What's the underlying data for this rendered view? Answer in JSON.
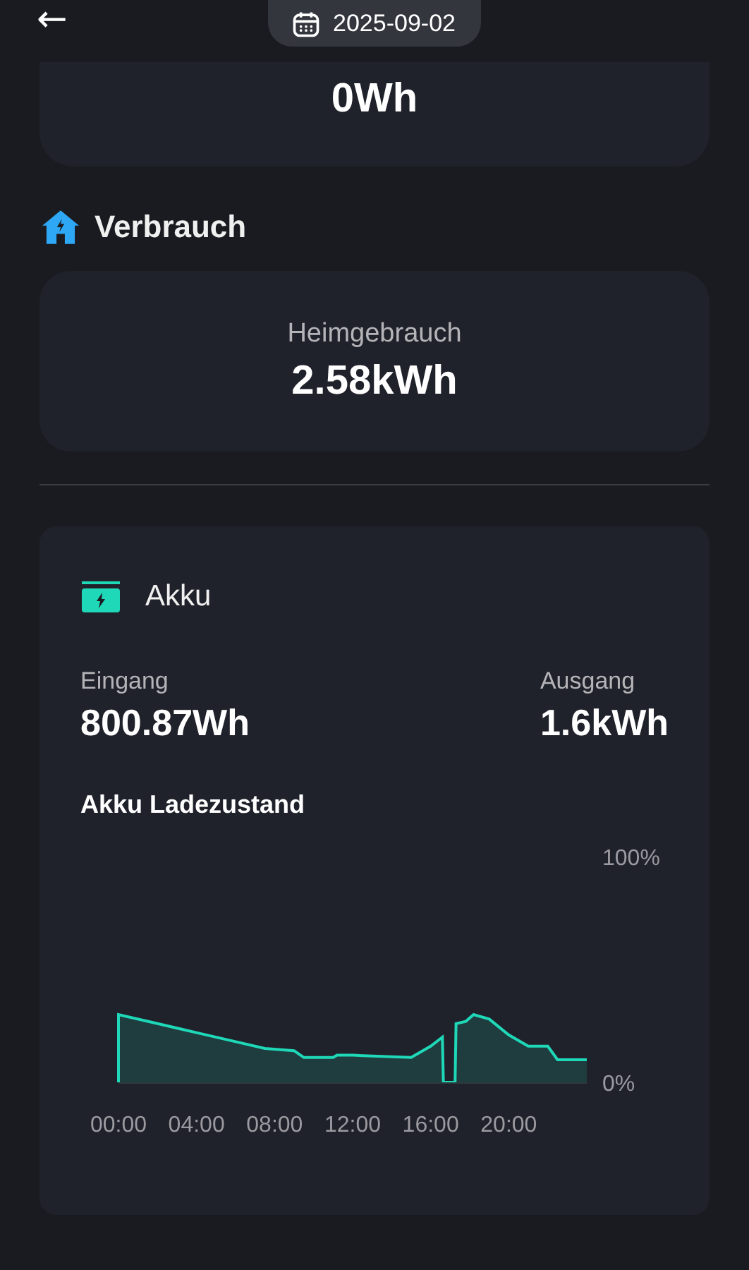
{
  "header": {
    "back_label": "←",
    "date": "2025-09-02"
  },
  "summary_card": {
    "value": "0Wh"
  },
  "consumption": {
    "title": "Verbrauch",
    "label": "Heimgebrauch",
    "value": "2.58kWh"
  },
  "battery": {
    "title": "Akku",
    "input_label": "Eingang",
    "input_value": "800.87Wh",
    "output_label": "Ausgang",
    "output_value": "1.6kWh",
    "chart_title": "Akku Ladezustand",
    "chart_data": {
      "type": "area",
      "x": [
        0,
        2,
        4,
        6,
        7.5,
        9,
        9.5,
        11,
        11.2,
        12,
        15,
        16,
        16.6,
        16.65,
        17.25,
        17.3,
        17.8,
        18.2,
        19,
        20,
        21,
        22,
        22.5,
        24
      ],
      "series": [
        {
          "color": "#1ed8b8",
          "values": [
            30,
            26,
            22,
            18,
            15,
            14,
            11,
            11,
            12,
            12,
            11,
            16,
            20,
            0,
            0,
            26,
            27,
            30,
            28,
            21,
            16,
            16,
            10,
            10
          ]
        }
      ],
      "xlim": [
        0,
        24
      ],
      "ylim": [
        0,
        100
      ],
      "xticks": [
        {
          "value": 0,
          "label": "00:00"
        },
        {
          "value": 4,
          "label": "04:00"
        },
        {
          "value": 8,
          "label": "08:00"
        },
        {
          "value": 12,
          "label": "12:00"
        },
        {
          "value": 16,
          "label": "16:00"
        },
        {
          "value": 20,
          "label": "20:00"
        }
      ],
      "yticks": [
        {
          "value": 0,
          "label": "0%"
        },
        {
          "value": 100,
          "label": "100%"
        }
      ]
    }
  }
}
